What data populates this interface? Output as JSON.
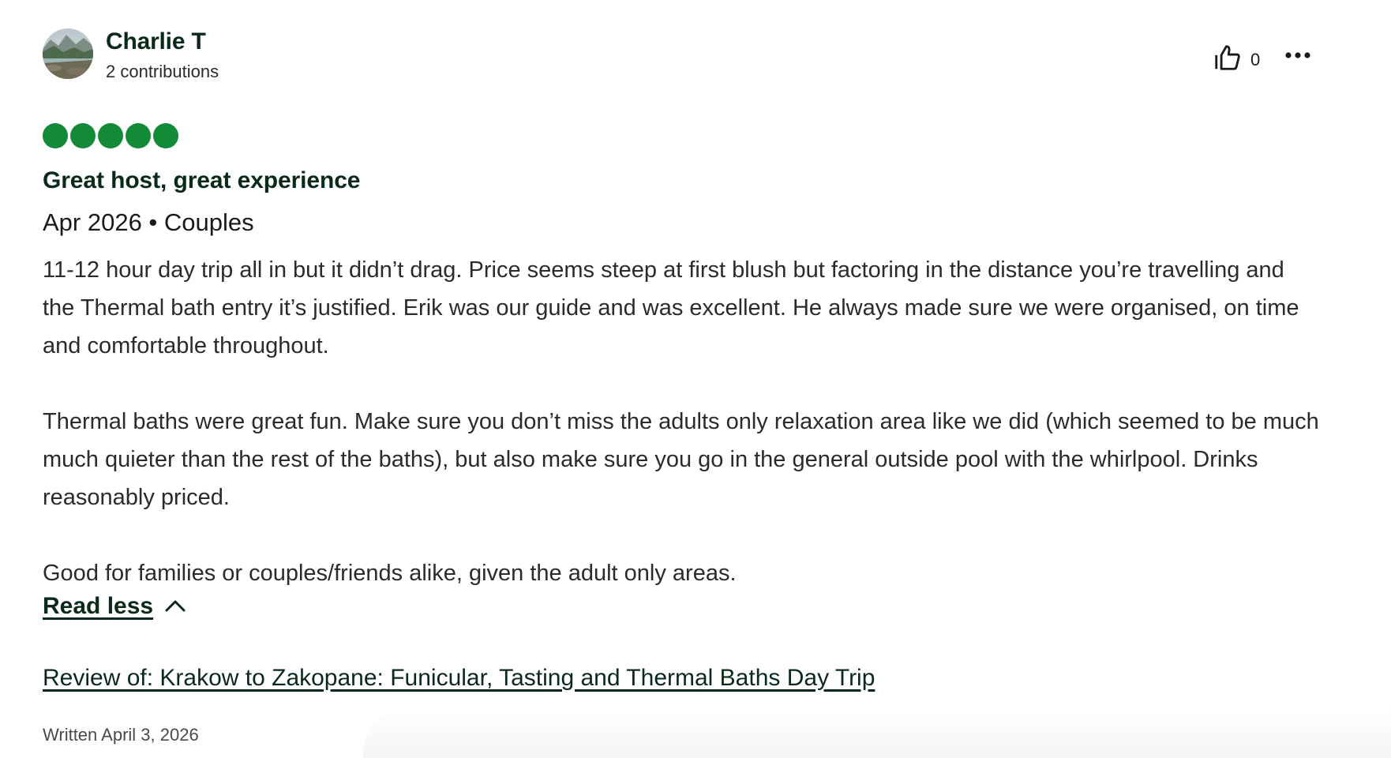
{
  "reviewer": {
    "name": "Charlie T",
    "contributions": "2 contributions"
  },
  "actions": {
    "helpful_count": "0",
    "helpful_icon": "thumbs-up-icon",
    "more_icon": "more-options-icon"
  },
  "rating": {
    "value": 5,
    "max": 5,
    "color": "#138a36"
  },
  "review": {
    "title": "Great host, great experience",
    "meta": "Apr 2026 • Couples",
    "paragraphs": [
      "11-12 hour day trip all in but it didn’t drag. Price seems steep at first blush but factoring in the distance you’re travelling and the Thermal bath entry it’s justified. Erik was our guide and was excellent. He always made sure we were organised, on time and comfortable throughout.",
      "Thermal baths were great fun. Make sure you don’t miss the adults only relaxation area like we did (which seemed to be much much quieter than the rest of the baths), but also make sure you go in the general outside pool with the whirlpool. Drinks reasonably priced.",
      "Good for families or couples/friends alike, given the adult only areas."
    ],
    "read_less_label": "Read less",
    "review_of": "Review of: Krakow to Zakopane: Funicular, Tasting and Thermal Baths Day Trip",
    "written": "Written April 3, 2026"
  },
  "colors": {
    "heading": "#0a2a19",
    "accent_green": "#138a36"
  }
}
